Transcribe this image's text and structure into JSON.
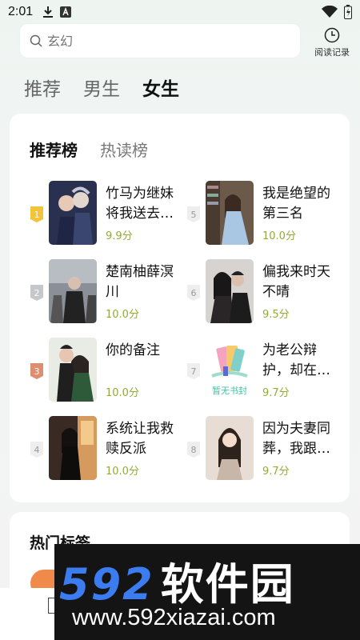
{
  "status_bar": {
    "time": "2:01",
    "icons": [
      "download-icon",
      "a-badge-icon",
      "wifi-icon",
      "battery-icon"
    ]
  },
  "search": {
    "placeholder": "玄幻",
    "history_label": "阅读记录"
  },
  "tabs": [
    {
      "label": "推荐",
      "active": false
    },
    {
      "label": "男生",
      "active": false
    },
    {
      "label": "女生",
      "active": true
    }
  ],
  "ranking": {
    "tabs": [
      {
        "label": "推荐榜",
        "active": true
      },
      {
        "label": "热读榜",
        "active": false
      }
    ],
    "books": [
      {
        "rank": "1",
        "title_line1": "竹马为继妹",
        "title_line2": "将我送去…",
        "score": "9.9分"
      },
      {
        "rank": "2",
        "title_line1": "楚南柚薛溟",
        "title_line2": "川",
        "score": "10.0分"
      },
      {
        "rank": "3",
        "title_line1": "你的备注",
        "title_line2": "",
        "score": "10.0分"
      },
      {
        "rank": "4",
        "title_line1": "系统让我救",
        "title_line2": "赎反派",
        "score": "10.0分"
      },
      {
        "rank": "5",
        "title_line1": "我是绝望的",
        "title_line2": "第三名",
        "score": "10.0分"
      },
      {
        "rank": "6",
        "title_line1": "偏我来时天",
        "title_line2": "不晴",
        "score": "9.5分"
      },
      {
        "rank": "7",
        "title_line1": "为老公辩",
        "title_line2": "护，却在…",
        "score": "9.7分",
        "cover_text": "暂无书封"
      },
      {
        "rank": "8",
        "title_line1": "因为夫妻同",
        "title_line2": "葬，我跟…",
        "score": "9.7分"
      }
    ]
  },
  "hot_tags": {
    "title": "热门标签"
  },
  "watermark": {
    "number": "592",
    "brand": "软件园",
    "url": "www.592xiazai.com"
  },
  "colors": {
    "score": "#8fac3a",
    "rank1": "#f1c43a",
    "rank2": "#c5c7cb",
    "rank3": "#dd8e71",
    "watermark_blue": "#3b7cf0"
  }
}
